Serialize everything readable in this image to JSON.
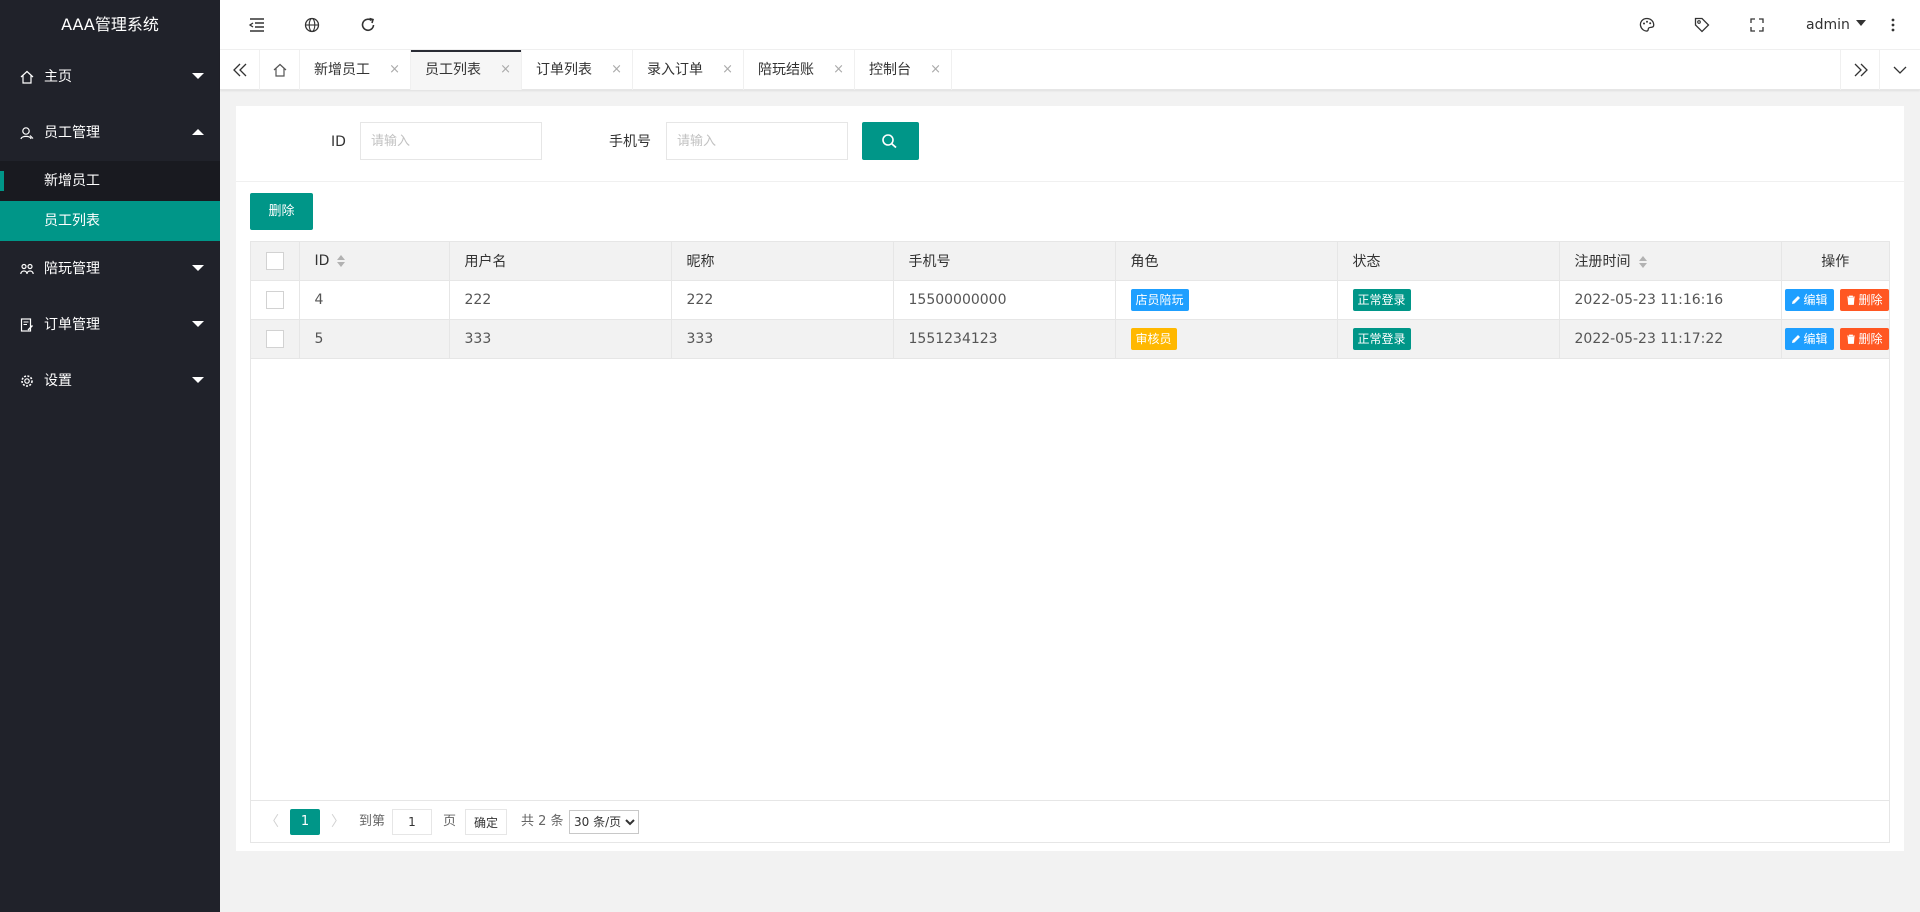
{
  "app": {
    "title": "AAA管理系统"
  },
  "colors": {
    "accent": "#009688",
    "sidebar_bg": "#20222a",
    "blue": "#1e9fff",
    "orange": "#ffb800",
    "red": "#ff5722"
  },
  "sidebar": {
    "items": [
      {
        "label": "主页",
        "icon": "home-icon"
      },
      {
        "label": "员工管理",
        "icon": "user-icon",
        "expanded": true,
        "children": [
          {
            "label": "新增员工"
          },
          {
            "label": "员工列表",
            "active": true
          }
        ]
      },
      {
        "label": "陪玩管理",
        "icon": "group-icon"
      },
      {
        "label": "订单管理",
        "icon": "order-icon"
      },
      {
        "label": "设置",
        "icon": "gear-icon"
      }
    ]
  },
  "header": {
    "user": "admin",
    "left_icons": [
      "shrink-icon",
      "globe-icon",
      "refresh-icon"
    ],
    "right_icons": [
      "palette-icon",
      "tag-icon",
      "fullscreen-icon",
      "more-icon"
    ]
  },
  "tabs": [
    {
      "label": "新增员工"
    },
    {
      "label": "员工列表",
      "active": true
    },
    {
      "label": "订单列表"
    },
    {
      "label": "录入订单"
    },
    {
      "label": "陪玩结账"
    },
    {
      "label": "控制台"
    }
  ],
  "tab_close_glyph": "×",
  "search": {
    "id_label": "ID",
    "id_placeholder": "请输入",
    "phone_label": "手机号",
    "phone_placeholder": "请输入"
  },
  "toolbar": {
    "delete_label": "删除"
  },
  "table": {
    "columns": [
      "ID",
      "用户名",
      "昵称",
      "手机号",
      "角色",
      "状态",
      "注册时间",
      "操作"
    ],
    "rows": [
      {
        "id": "4",
        "username": "222",
        "nickname": "222",
        "phone": "15500000000",
        "role": "店员陪玩",
        "role_color": "#1e9fff",
        "status": "正常登录",
        "registered": "2022-05-23 11:16:16"
      },
      {
        "id": "5",
        "username": "333",
        "nickname": "333",
        "phone": "1551234123",
        "role": "审核员",
        "role_color": "#ffb800",
        "status": "正常登录",
        "registered": "2022-05-23 11:17:22"
      }
    ],
    "actions": {
      "edit": "编辑",
      "delete": "删除"
    }
  },
  "pagination": {
    "prev": "〈",
    "next": "〉",
    "current": "1",
    "goto_prefix": "到第",
    "goto_value": "1",
    "goto_suffix": "页",
    "confirm": "确定",
    "total": "共 2 条",
    "page_size": "30 条/页"
  }
}
